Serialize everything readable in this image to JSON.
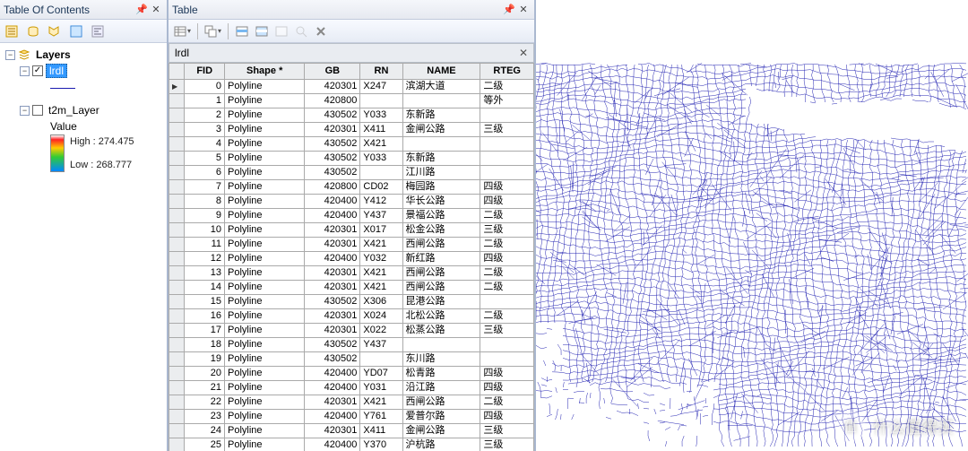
{
  "toc": {
    "title": "Table Of Contents",
    "layers_label": "Layers",
    "lrdl_label": "lrdl",
    "t2m_label": "t2m_Layer",
    "value_label": "Value",
    "high_label": "High : 274.475",
    "low_label": "Low : 268.777"
  },
  "table": {
    "title": "Table",
    "layer_name": "lrdl",
    "columns": [
      "FID",
      "Shape *",
      "GB",
      "RN",
      "NAME",
      "RTEG"
    ],
    "rows": [
      {
        "fid": 0,
        "shape": "Polyline",
        "gb": "420301",
        "rn": "X247",
        "name": "滨湖大道",
        "rteg": "二级"
      },
      {
        "fid": 1,
        "shape": "Polyline",
        "gb": "420800",
        "rn": "",
        "name": "",
        "rteg": "等外"
      },
      {
        "fid": 2,
        "shape": "Polyline",
        "gb": "430502",
        "rn": "Y033",
        "name": "东新路",
        "rteg": ""
      },
      {
        "fid": 3,
        "shape": "Polyline",
        "gb": "420301",
        "rn": "X411",
        "name": "金闸公路",
        "rteg": "三级"
      },
      {
        "fid": 4,
        "shape": "Polyline",
        "gb": "430502",
        "rn": "X421",
        "name": "",
        "rteg": ""
      },
      {
        "fid": 5,
        "shape": "Polyline",
        "gb": "430502",
        "rn": "Y033",
        "name": "东新路",
        "rteg": ""
      },
      {
        "fid": 6,
        "shape": "Polyline",
        "gb": "430502",
        "rn": "",
        "name": "江川路",
        "rteg": ""
      },
      {
        "fid": 7,
        "shape": "Polyline",
        "gb": "420800",
        "rn": "CD02",
        "name": "梅园路",
        "rteg": "四级"
      },
      {
        "fid": 8,
        "shape": "Polyline",
        "gb": "420400",
        "rn": "Y412",
        "name": "华长公路",
        "rteg": "四级"
      },
      {
        "fid": 9,
        "shape": "Polyline",
        "gb": "420400",
        "rn": "Y437",
        "name": "景福公路",
        "rteg": "二级"
      },
      {
        "fid": 10,
        "shape": "Polyline",
        "gb": "420301",
        "rn": "X017",
        "name": "松金公路",
        "rteg": "三级"
      },
      {
        "fid": 11,
        "shape": "Polyline",
        "gb": "420301",
        "rn": "X421",
        "name": "西闸公路",
        "rteg": "二级"
      },
      {
        "fid": 12,
        "shape": "Polyline",
        "gb": "420400",
        "rn": "Y032",
        "name": "新红路",
        "rteg": "四级"
      },
      {
        "fid": 13,
        "shape": "Polyline",
        "gb": "420301",
        "rn": "X421",
        "name": "西闸公路",
        "rteg": "二级"
      },
      {
        "fid": 14,
        "shape": "Polyline",
        "gb": "420301",
        "rn": "X421",
        "name": "西闸公路",
        "rteg": "二级"
      },
      {
        "fid": 15,
        "shape": "Polyline",
        "gb": "430502",
        "rn": "X306",
        "name": "昆港公路",
        "rteg": ""
      },
      {
        "fid": 16,
        "shape": "Polyline",
        "gb": "420301",
        "rn": "X024",
        "name": "北松公路",
        "rteg": "二级"
      },
      {
        "fid": 17,
        "shape": "Polyline",
        "gb": "420301",
        "rn": "X022",
        "name": "松蒸公路",
        "rteg": "三级"
      },
      {
        "fid": 18,
        "shape": "Polyline",
        "gb": "430502",
        "rn": "Y437",
        "name": "",
        "rteg": ""
      },
      {
        "fid": 19,
        "shape": "Polyline",
        "gb": "430502",
        "rn": "",
        "name": "东川路",
        "rteg": ""
      },
      {
        "fid": 20,
        "shape": "Polyline",
        "gb": "420400",
        "rn": "YD07",
        "name": "松青路",
        "rteg": "四级"
      },
      {
        "fid": 21,
        "shape": "Polyline",
        "gb": "420400",
        "rn": "Y031",
        "name": "沿江路",
        "rteg": "四级"
      },
      {
        "fid": 22,
        "shape": "Polyline",
        "gb": "420301",
        "rn": "X421",
        "name": "西闸公路",
        "rteg": "二级"
      },
      {
        "fid": 23,
        "shape": "Polyline",
        "gb": "420400",
        "rn": "Y761",
        "name": "爱普尔路",
        "rteg": "四级"
      },
      {
        "fid": 24,
        "shape": "Polyline",
        "gb": "420301",
        "rn": "X411",
        "name": "金闸公路",
        "rteg": "三级"
      },
      {
        "fid": 25,
        "shape": "Polyline",
        "gb": "420400",
        "rn": "Y370",
        "name": "沪杭路",
        "rteg": "三级"
      }
    ]
  },
  "watermark": {
    "badge": "值",
    "text": "什么值得买"
  }
}
